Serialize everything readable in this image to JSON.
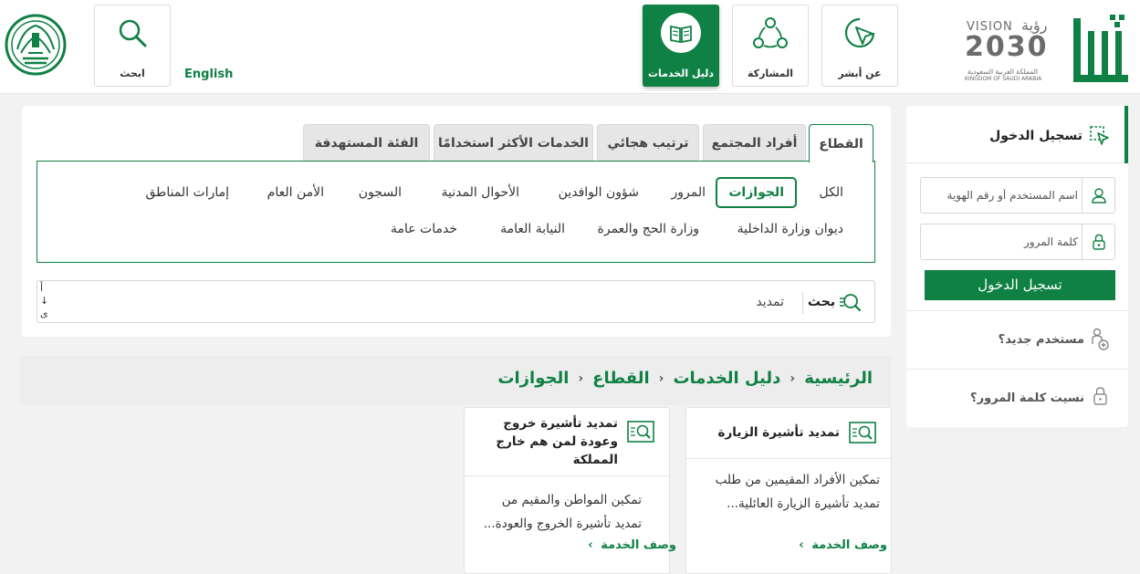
{
  "header": {
    "nav": {
      "about": "عن أبشر",
      "participation": "المشاركة",
      "services_guide": "دليل الخدمات",
      "search": "ابحث"
    },
    "language_link": "English",
    "logo": {
      "vision_text": "VISION",
      "vision_arabic": "رؤية",
      "year": "2030",
      "kingdom_ar": "المملكة العربية السعودية",
      "kingdom_en": "KINGDOM OF SAUDI ARABIA",
      "brand": "أبشر"
    }
  },
  "tabs": [
    "القطاع",
    "أفراد المجتمع",
    "ترتيب هجائي",
    "الخدمات الأكثر استخدامًا",
    "الفئة المستهدفة"
  ],
  "sectors": {
    "row1": [
      "الكل",
      "الجوازات",
      "المرور",
      "شؤون الوافدين",
      "الأحوال المدنية",
      "السجون",
      "الأمن العام",
      "إمارات المناطق"
    ],
    "row2": [
      "ديوان وزارة الداخلية",
      "وزارة الحج والعمرة",
      "النيابة العامة",
      "خدمات عامة"
    ],
    "selected": "الجوازات"
  },
  "search": {
    "label": "بحث",
    "value": "تمديد",
    "side_glyphs": [
      "أ",
      "↓",
      "ى"
    ]
  },
  "breadcrumb": [
    "الرئيسية",
    "دليل الخدمات",
    "القطاع",
    "الجوازات"
  ],
  "service_cards": [
    {
      "title": "تمديد تأشيرة الزيارة",
      "description": "تمكين الأفراد المقيمين من طلب تمديد تأشيرة الزيارة العائلية...",
      "link": "وصف الخدمة"
    },
    {
      "title": "تمديد تأشيرة خروج وعودة لمن هم خارج المملكة",
      "description": "تمكين المواطن والمقيم من تمديد تأشيرة الخروج والعودة...",
      "link": "وصف الخدمة"
    }
  ],
  "login": {
    "title": "تسجيل الدخول",
    "username_placeholder": "اسم المستخدم أو رقم الهوية",
    "password_placeholder": "كلمة المرور",
    "button": "تسجيل الدخول",
    "new_user": "مستخدم جديد؟",
    "forgot_password": "نسيت كلمة المرور؟"
  },
  "colors": {
    "primary": "#0f8144",
    "background": "#f2f2f2"
  }
}
